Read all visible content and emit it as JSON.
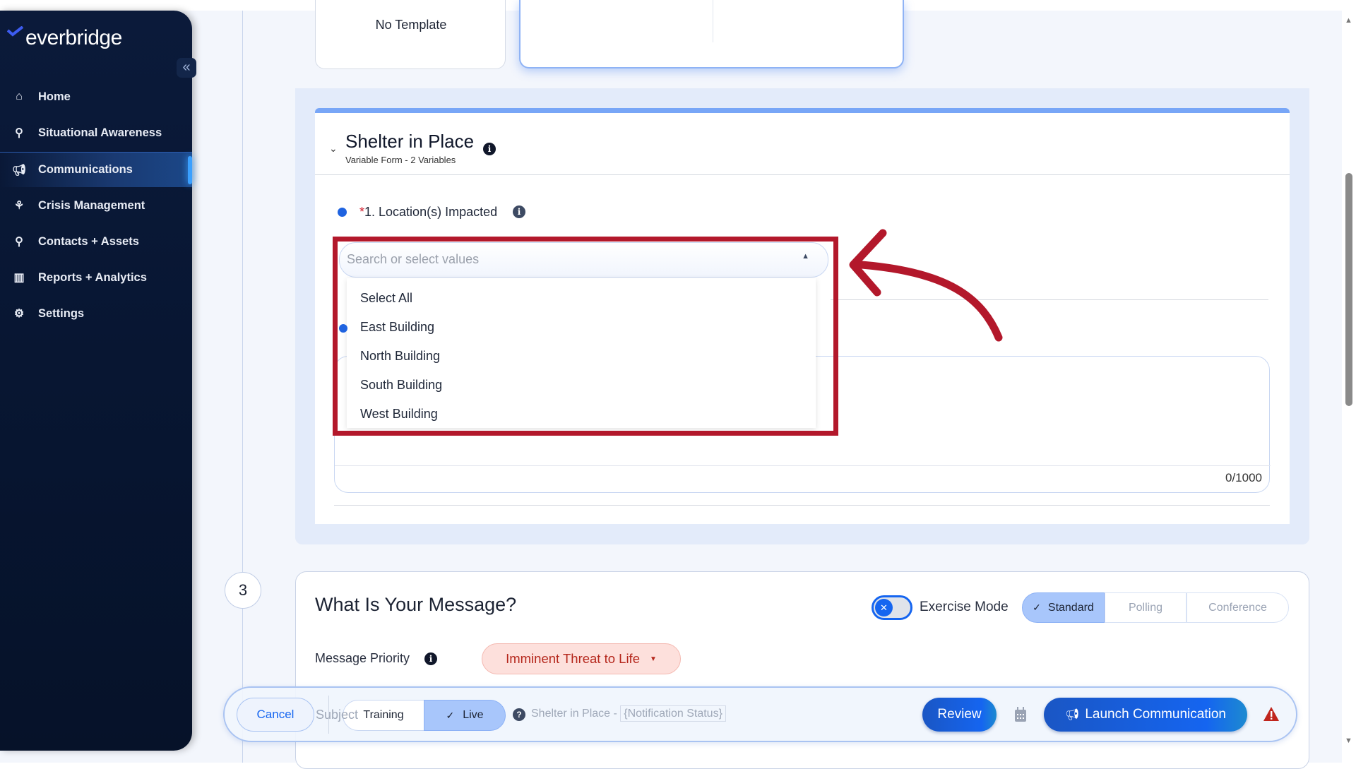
{
  "sidebar": {
    "brand": "everbridge",
    "items": [
      {
        "label": "Home",
        "icon": "home-icon"
      },
      {
        "label": "Situational Awareness",
        "icon": "map-icon"
      },
      {
        "label": "Communications",
        "icon": "megaphone-icon",
        "active": true
      },
      {
        "label": "Crisis Management",
        "icon": "crisis-icon"
      },
      {
        "label": "Contacts + Assets",
        "icon": "location-pin-icon"
      },
      {
        "label": "Reports + Analytics",
        "icon": "chart-icon"
      },
      {
        "label": "Settings",
        "icon": "gear-icon"
      }
    ]
  },
  "templates": {
    "no_template": "No Template"
  },
  "form": {
    "title": "Shelter in Place",
    "subtitle": "Variable Form - 2 Variables",
    "field_required": "*",
    "field_label": "1. Location(s) Impacted",
    "search_placeholder": "Search or select values",
    "options": [
      "Select All",
      "East Building",
      "North Building",
      "South Building",
      "West Building"
    ],
    "char_count": "0/1000"
  },
  "step2": {
    "number": "3",
    "title": "What Is Your Message?",
    "exercise_mode": "Exercise Mode",
    "exercise_on": false,
    "modes": [
      "Standard",
      "Polling",
      "Conference"
    ],
    "selected_mode": "Standard",
    "priority_label": "Message Priority",
    "priority_value": "Imminent Threat to Life",
    "subject_label": "Subject",
    "subject_value": "Shelter in Place - ",
    "subject_var": "{Notification Status}"
  },
  "bottom": {
    "cancel": "Cancel",
    "training": "Training",
    "live": "Live",
    "selected": "Live",
    "review": "Review",
    "launch": "Launch Communication"
  },
  "colors": {
    "accent": "#1565f0",
    "annotation": "#b3182b",
    "sidebar": "#0b1a3a"
  }
}
